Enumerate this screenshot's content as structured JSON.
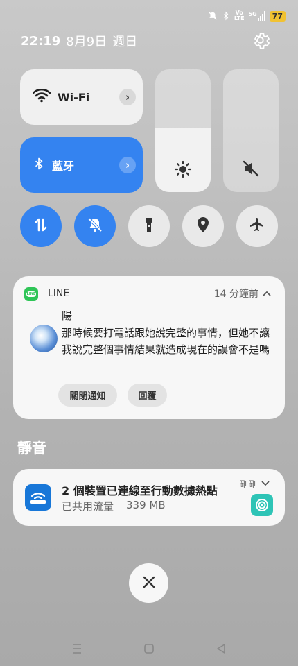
{
  "status_bar": {
    "icons": [
      "mute-notification-icon",
      "bluetooth-icon",
      "volte-icon",
      "5g-signal-icon"
    ],
    "volte_top": "Vo",
    "volte_bottom": "LTE",
    "network": "5G",
    "battery": "77",
    "battery_color": "#f1c232"
  },
  "header": {
    "time": "22:19",
    "date": "8月9日",
    "weekday": "週日"
  },
  "quick_settings": {
    "wifi_label": "Wi-Fi",
    "bluetooth_label": "藍牙",
    "brightness_level": 0.52,
    "volume_level": 0,
    "round_toggles": [
      {
        "name": "mobile-data-icon",
        "active": true
      },
      {
        "name": "do-not-disturb-icon",
        "active": true
      },
      {
        "name": "flashlight-icon",
        "active": false
      },
      {
        "name": "location-icon",
        "active": false
      },
      {
        "name": "airplane-mode-icon",
        "active": false
      }
    ],
    "accent": "#3483f0"
  },
  "line_notification": {
    "app_name": "LINE",
    "time": "14 分鐘前",
    "sender": "陽",
    "message": "那時候要打電話跟她說完整的事情，但她不讓我說完整個事情結果就造成現在的誤會不是嗎",
    "actions": [
      "關閉通知",
      "回覆"
    ]
  },
  "silent_section": {
    "title": "靜音"
  },
  "hotspot_notification": {
    "title": "2 個裝置已連線至行動數據熱點",
    "usage_label": "已共用流量",
    "usage_value": "339 MB",
    "time": "剛剛"
  },
  "navigation": {
    "buttons": [
      "menu-icon",
      "home-icon",
      "back-icon"
    ]
  }
}
